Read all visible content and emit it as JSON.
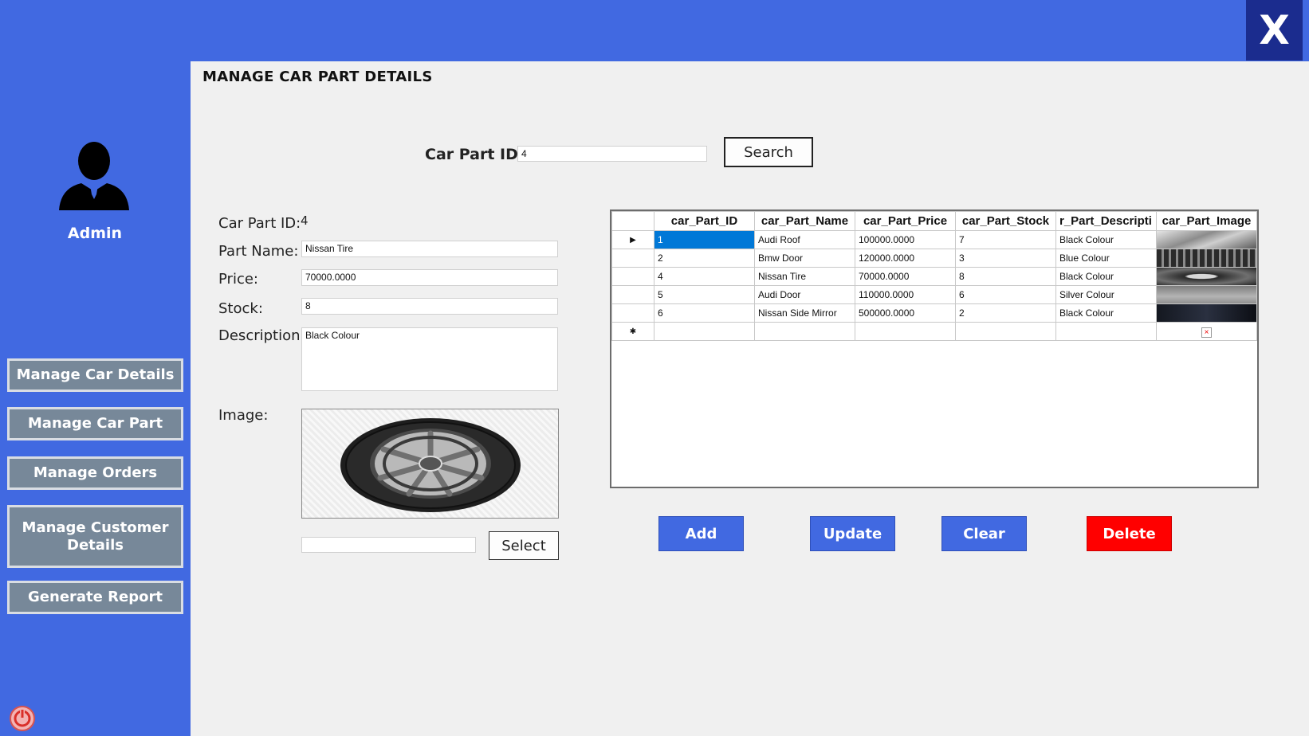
{
  "window": {
    "close_label": "X"
  },
  "sidebar": {
    "user_label": "Admin",
    "nav": [
      {
        "label": "Manage Car Details"
      },
      {
        "label": "Manage Car Part"
      },
      {
        "label": "Manage Orders"
      },
      {
        "label": "Manage Customer Details"
      },
      {
        "label": "Generate Report"
      }
    ]
  },
  "main": {
    "title": "MANAGE CAR PART DETAILS",
    "search": {
      "label": "Car Part ID:",
      "value": "4",
      "button": "Search"
    },
    "form": {
      "id_label": "Car Part ID:",
      "id_value": "4",
      "name_label": "Part Name:",
      "name_value": "Nissan Tire",
      "price_label": "Price:",
      "price_value": "70000.0000",
      "stock_label": "Stock:",
      "stock_value": "8",
      "description_label": "Description:",
      "description_value": "Black Colour",
      "image_label": "Image:",
      "image_path_value": "",
      "select_button": "Select"
    },
    "grid": {
      "columns": [
        "car_Part_ID",
        "car_Part_Name",
        "car_Part_Price",
        "car_Part_Stock",
        "r_Part_Descripti",
        "car_Part_Image"
      ],
      "rows": [
        {
          "id": "1",
          "name": "Audi Roof",
          "price": "100000.0000",
          "stock": "7",
          "description": "Black Colour",
          "image": "roof"
        },
        {
          "id": "2",
          "name": "Bmw Door",
          "price": "120000.0000",
          "stock": "3",
          "description": "Blue Colour",
          "image": "grille"
        },
        {
          "id": "4",
          "name": "Nissan Tire",
          "price": "70000.0000",
          "stock": "8",
          "description": "Black Colour",
          "image": "grille"
        },
        {
          "id": "5",
          "name": "Audi Door",
          "price": "110000.0000",
          "stock": "6",
          "description": "Silver Colour",
          "image": "silver"
        },
        {
          "id": "6",
          "name": "Nissan Side Mirror",
          "price": "500000.0000",
          "stock": "2",
          "description": "Black Colour",
          "image": "dark"
        }
      ]
    },
    "actions": {
      "add": "Add",
      "update": "Update",
      "clear": "Clear",
      "delete": "Delete"
    }
  },
  "colors": {
    "sidebar_bg": "#4169e1",
    "close_bg": "#1b2c8e",
    "nav_button": "#778899",
    "action_button": "#4169e1",
    "delete_button": "#ff0000",
    "selection": "#0078d7"
  }
}
